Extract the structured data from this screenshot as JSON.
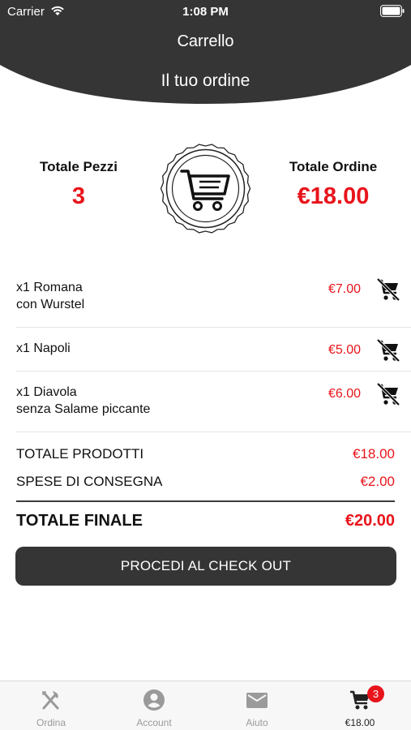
{
  "status_bar": {
    "carrier": "Carrier",
    "time": "1:08 PM"
  },
  "header": {
    "nav_title": "Carrello",
    "page_title": "Il tuo ordine",
    "background_color": "#353535"
  },
  "summary": {
    "pieces_label": "Totale Pezzi",
    "pieces_value": "3",
    "order_label": "Totale Ordine",
    "order_value": "€18.00",
    "icon": "shopping-cart-icon"
  },
  "items": [
    {
      "line1": "x1 Romana",
      "line2": "con Wurstel",
      "price": "€7.00",
      "remove_icon": "remove-from-cart-icon"
    },
    {
      "line1": "x1 Napoli",
      "line2": "",
      "price": "€5.00",
      "remove_icon": "remove-from-cart-icon"
    },
    {
      "line1": "x1 Diavola",
      "line2": "senza Salame piccante",
      "price": "€6.00",
      "remove_icon": "remove-from-cart-icon"
    }
  ],
  "totals": {
    "products_label": "TOTALE PRODOTTI",
    "products_value": "€18.00",
    "delivery_label": "SPESE DI CONSEGNA",
    "delivery_value": "€2.00",
    "final_label": "TOTALE FINALE",
    "final_value": "€20.00"
  },
  "checkout_button": "PROCEDI AL CHECK OUT",
  "tabbar": {
    "tabs": [
      {
        "label": "Ordina",
        "icon": "fork-knife-icon",
        "active": false
      },
      {
        "label": "Account",
        "icon": "account-icon",
        "active": false
      },
      {
        "label": "Aiuto",
        "icon": "mail-icon",
        "active": false
      },
      {
        "label": "€18.00",
        "icon": "cart-icon",
        "active": true,
        "badge": "3"
      }
    ]
  },
  "colors": {
    "accent": "#e8141b",
    "dark": "#353535"
  }
}
